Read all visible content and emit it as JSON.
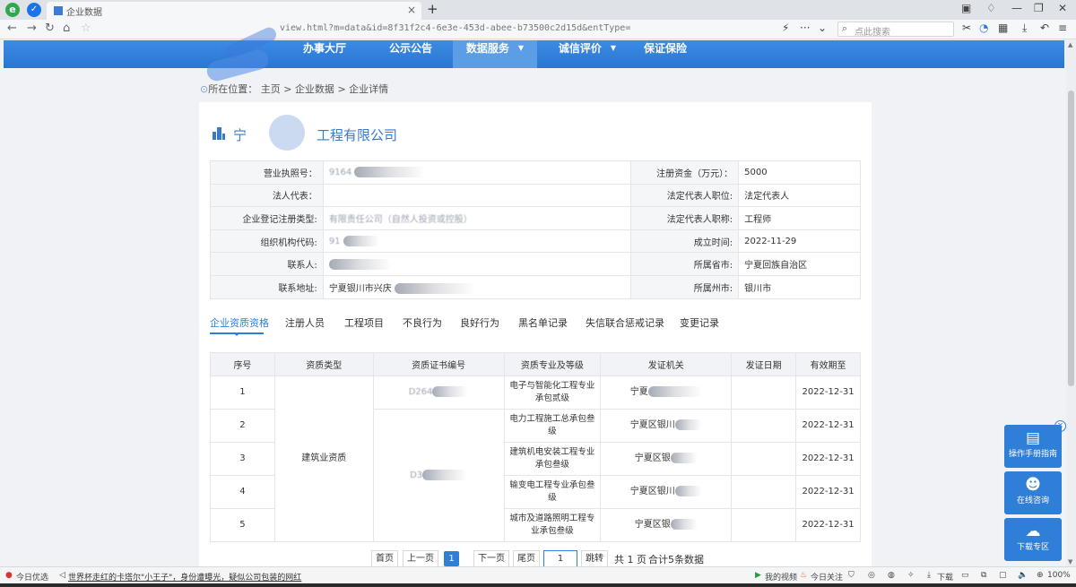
{
  "browser": {
    "tab_title": "企业数据",
    "new_tab": "+",
    "url": "view.html?m=data&id=8f31f2c4-6e3e-453d-abee-b73500c2d15d&entType=",
    "search_placeholder": "点此搜索",
    "zoom": "100%"
  },
  "nav": {
    "items": [
      {
        "label": "办事大厅"
      },
      {
        "label": "公示公告"
      },
      {
        "label": "数据服务"
      },
      {
        "label": "诚信评价"
      },
      {
        "label": "保证保险"
      }
    ]
  },
  "breadcrumb": {
    "prefix": "所在位置：",
    "home": "主页",
    "sep1": ">",
    "level2": "企业数据",
    "sep2": ">",
    "current": "企业详情"
  },
  "company": {
    "name_start": "宁",
    "name_end": "工程有限公司"
  },
  "info": {
    "rows": [
      {
        "l1": "营业执照号：",
        "v1": "9164",
        "l2": "注册资金（万元）：",
        "v2": "5000"
      },
      {
        "l1": "法人代表：",
        "v1": "",
        "l2": "法定代表人职位:",
        "v2": "法定代表人"
      },
      {
        "l1": "企业登记注册类型:",
        "v1": "有限责任公司（自然人投资或控股）",
        "l2": "法定代表人职称:",
        "v2": "工程师"
      },
      {
        "l1": "组织机构代码:",
        "v1": "91",
        "l2": "成立时间:",
        "v2": "2022-11-29"
      },
      {
        "l1": "联系人:",
        "v1": "",
        "l2": "所属省市:",
        "v2": "宁夏回族自治区"
      },
      {
        "l1": "联系地址:",
        "v1": "宁夏银川市兴庆",
        "l2": "所属州市:",
        "v2": "银川市"
      }
    ]
  },
  "tabs": {
    "items": [
      "企业资质资格",
      "注册人员",
      "工程项目",
      "不良行为",
      "良好行为",
      "黑名单记录",
      "失信联合惩戒记录",
      "变更记录"
    ]
  },
  "qual": {
    "headers": [
      "序号",
      "资质类型",
      "资质证书编号",
      "资质专业及等级",
      "发证机关",
      "发证日期",
      "有效期至"
    ],
    "type": "建筑业资质",
    "cert_a": "D264",
    "cert_b": "D3",
    "rows": [
      {
        "no": "1",
        "spec": "电子与智能化工程专业承包贰级",
        "issuer": "宁夏",
        "expire": "2022-12-31"
      },
      {
        "no": "2",
        "spec": "电力工程施工总承包叁级",
        "issuer": "宁夏区银川",
        "expire": "2022-12-31"
      },
      {
        "no": "3",
        "spec": "建筑机电安装工程专业承包叁级",
        "issuer": "宁夏区银",
        "expire": "2022-12-31"
      },
      {
        "no": "4",
        "spec": "输变电工程专业承包叁级",
        "issuer": "宁夏区银川",
        "expire": "2022-12-31"
      },
      {
        "no": "5",
        "spec": "城市及道路照明工程专业承包叁级",
        "issuer": "宁夏区银",
        "expire": "2022-12-31"
      }
    ]
  },
  "pager": {
    "first": "首页",
    "prev": "上一页",
    "current": "1",
    "next": "下一页",
    "last": "尾页",
    "input": "1",
    "go": "跳转",
    "total_pages": "共 1 页",
    "total_items": "合计5条数据"
  },
  "float_panel": {
    "manual": "操作手册指南",
    "consult": "在线咨询",
    "download": "下载专区",
    "close": "×"
  },
  "statusbar": {
    "left": "今日优选",
    "news": "世界杯走红的卡塔尔\"小王子\"，身份遭曝光，疑似公司包装的网红",
    "video": "我的视频",
    "hot": "今日关注",
    "download": "下载",
    "zoom": "100%"
  },
  "colors": {
    "primary": "#2f7ed8",
    "nav_active": "#5b9ee6",
    "company_name": "#3a79c5"
  }
}
